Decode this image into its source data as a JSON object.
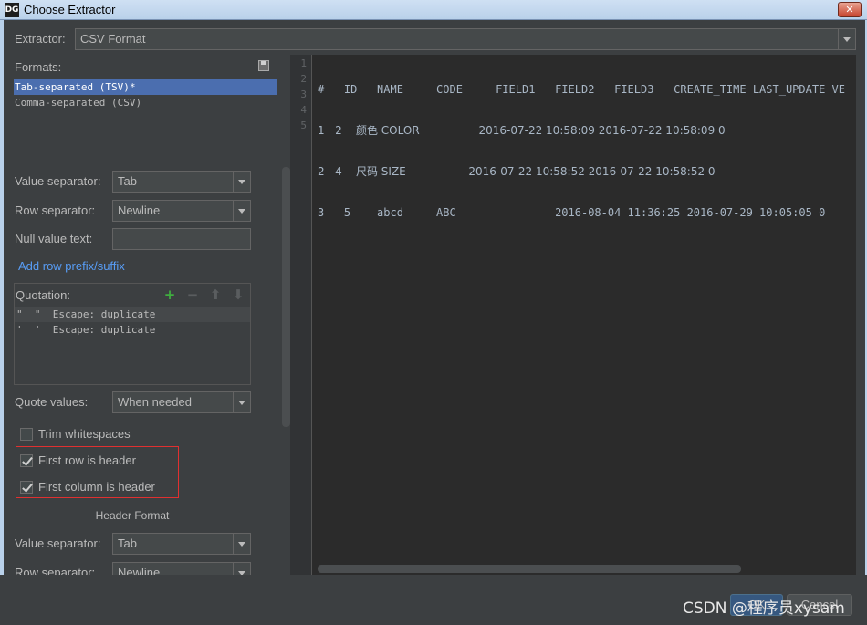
{
  "window": {
    "app_icon": "DG",
    "title": "Choose Extractor",
    "close": "✕"
  },
  "extractor": {
    "label": "Extractor:",
    "value": "CSV Format"
  },
  "formats": {
    "label": "Formats:",
    "items": [
      "Tab-separated (TSV)*",
      "Comma-separated (CSV)"
    ],
    "selected_index": 0
  },
  "value_separator": {
    "label": "Value separator:",
    "value": "Tab"
  },
  "row_separator": {
    "label": "Row separator:",
    "value": "Newline"
  },
  "null_value_text": {
    "label": "Null value text:",
    "value": ""
  },
  "add_row_prefix_link": "Add row prefix/suffix",
  "quotation": {
    "label": "Quotation:",
    "items": [
      "\"  \"  Escape: duplicate",
      "'  '  Escape: duplicate"
    ]
  },
  "quote_values": {
    "label": "Quote values:",
    "value": "When needed"
  },
  "options": {
    "trim_whitespaces": {
      "label": "Trim whitespaces",
      "checked": false
    },
    "first_row_header": {
      "label": "First row is header",
      "checked": true
    },
    "first_column_header": {
      "label": "First column is header",
      "checked": true
    }
  },
  "header_format": {
    "title": "Header Format",
    "value_separator": {
      "label": "Value separator:",
      "value": "Tab"
    },
    "row_separator": {
      "label": "Row separator:",
      "value": "Newline"
    }
  },
  "preview": {
    "line_numbers": [
      "1",
      "2",
      "3",
      "4",
      "5"
    ],
    "rows": [
      "#   ID   NAME     CODE     FIELD1   FIELD2   FIELD3   CREATE_TIME LAST_UPDATE VE",
      "1   2    颜色 COLOR                 2016-07-22 10:58:09 2016-07-22 10:58:09 0",
      "2   4    尺码 SIZE                  2016-07-22 10:58:52 2016-07-22 10:58:52 0",
      "3   5    abcd     ABC               2016-08-04 11:36:25 2016-07-29 10:05:05 0",
      ""
    ]
  },
  "buttons": {
    "ok": "OK",
    "cancel": "Cancel"
  },
  "watermark": "CSDN @程序员xysam",
  "colors": {
    "accent": "#4b6eaf",
    "link": "#589df6",
    "highlight_border": "#e03030",
    "background": "#3c3f41"
  },
  "icons": [
    "save-icon",
    "plus-icon",
    "minus-icon",
    "arrow-up-icon",
    "arrow-down-icon",
    "chevron-down-icon",
    "close-icon"
  ]
}
